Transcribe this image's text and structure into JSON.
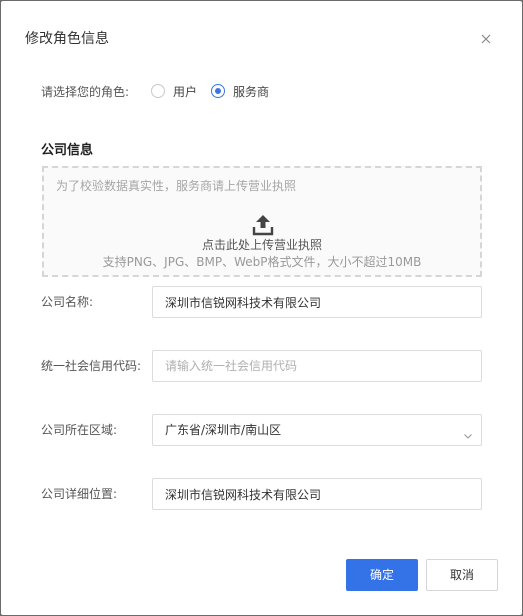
{
  "dialog": {
    "title": "修改角色信息",
    "close_icon": "close-icon"
  },
  "role": {
    "label": "请选择您的角色:",
    "options": [
      {
        "label": "用户",
        "checked": false
      },
      {
        "label": "服务商",
        "checked": true
      }
    ]
  },
  "company": {
    "section_title": "公司信息",
    "upload": {
      "tip": "为了校验数据真实性，服务商请上传营业执照",
      "icon": "upload-icon",
      "text": "点击此处上传营业执照",
      "hint": "支持PNG、JPG、BMP、WebP格式文件，大小不超过10MB"
    },
    "name": {
      "label": "公司名称:",
      "value": "深圳市信锐网科技术有限公司"
    },
    "credit_code": {
      "label": "统一社会信用代码:",
      "placeholder": "请输入统一社会信用代码",
      "value": ""
    },
    "region": {
      "label": "公司所在区域:",
      "value": "广东省/深圳市/南山区",
      "icon": "chevron-down-icon"
    },
    "address": {
      "label": "公司详细位置:",
      "value": "深圳市信锐网科技术有限公司"
    }
  },
  "actions": {
    "confirm": "确定",
    "cancel": "取消"
  },
  "colors": {
    "primary": "#3472e8",
    "radio_checked": "#3b74e6"
  }
}
